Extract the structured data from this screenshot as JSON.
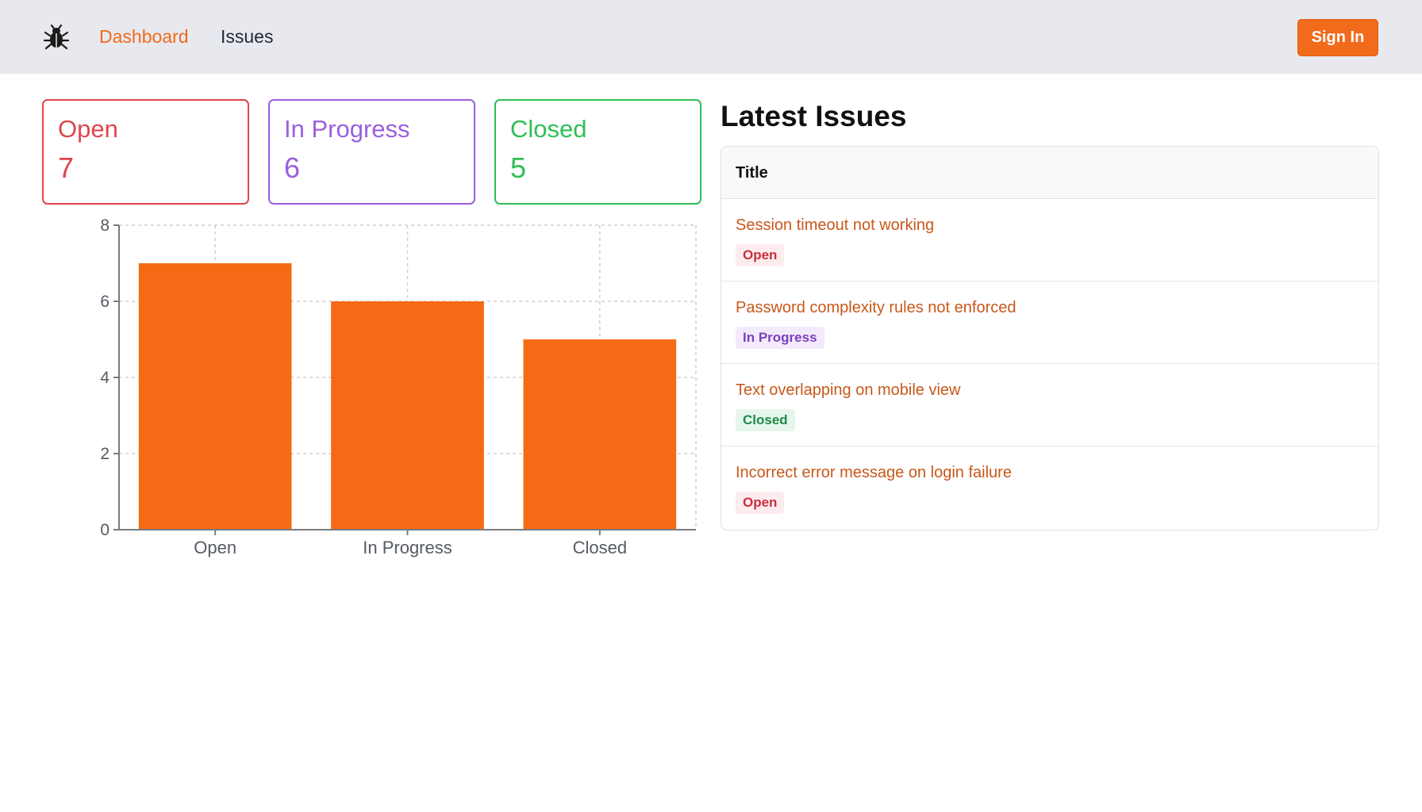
{
  "nav": {
    "logo_icon": "bug-icon",
    "links": [
      "Dashboard",
      "Issues"
    ],
    "active": "Dashboard",
    "signin_label": "Sign In"
  },
  "colors": {
    "accent": "#f26a1b",
    "open": "#e0454d",
    "in_progress": "#9b5fe0",
    "closed": "#2fbf55"
  },
  "stats": [
    {
      "label": "Open",
      "count": "7"
    },
    {
      "label": "In Progress",
      "count": "6"
    },
    {
      "label": "Closed",
      "count": "5"
    }
  ],
  "chart_data": {
    "type": "bar",
    "categories": [
      "Open",
      "In Progress",
      "Closed"
    ],
    "values": [
      7,
      6,
      5
    ],
    "ylim": [
      0,
      8
    ],
    "yticks": [
      "0",
      "2",
      "4",
      "6",
      "8"
    ],
    "grid": true,
    "bar_color": "#f56a15"
  },
  "latest": {
    "heading": "Latest Issues",
    "column_header": "Title",
    "issues": [
      {
        "title": "Session timeout not working",
        "status": "Open"
      },
      {
        "title": "Password complexity rules not enforced",
        "status": "In Progress"
      },
      {
        "title": "Text overlapping on mobile view",
        "status": "Closed"
      },
      {
        "title": "Incorrect error message on login failure",
        "status": "Open"
      }
    ]
  }
}
